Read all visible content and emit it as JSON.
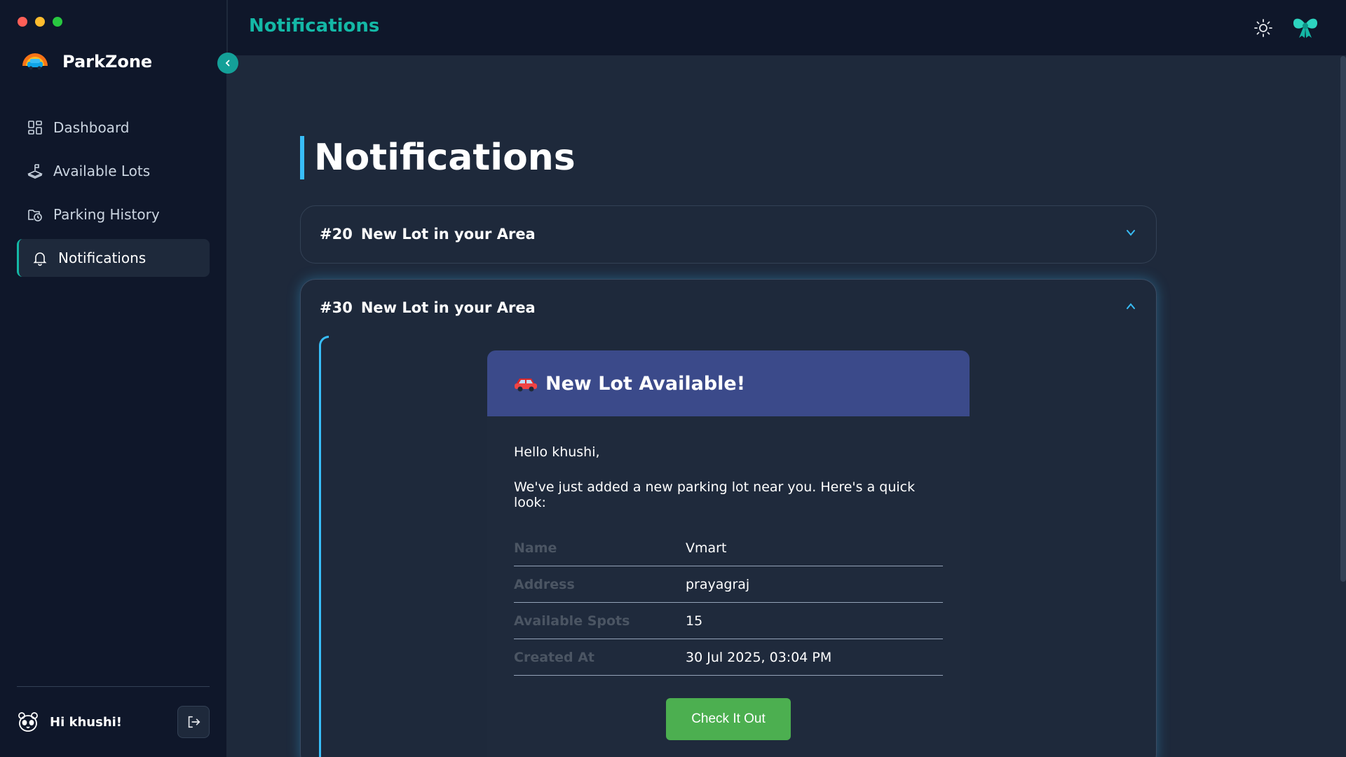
{
  "app": {
    "name": "ParkZone"
  },
  "sidebar": {
    "items": [
      {
        "label": "Dashboard",
        "icon": "dashboard-icon",
        "active": false
      },
      {
        "label": "Available Lots",
        "icon": "parking-lot-icon",
        "active": false
      },
      {
        "label": "Parking History",
        "icon": "history-icon",
        "active": false
      },
      {
        "label": "Notifications",
        "icon": "bell-icon",
        "active": true
      }
    ],
    "user_greeting": "Hi khushi!"
  },
  "topbar": {
    "title": "Notifications"
  },
  "main": {
    "page_title": "Notifications",
    "notifications": [
      {
        "number": "#20",
        "title": "New Lot in your Area",
        "expanded": false
      },
      {
        "number": "#30",
        "title": "New Lot in your Area",
        "expanded": true
      }
    ],
    "email": {
      "heading": "New Lot Available!",
      "greeting": "Hello khushi,",
      "intro": "We've just added a new parking lot near you. Here's a quick look:",
      "details": [
        {
          "label": "Name",
          "value": "Vmart"
        },
        {
          "label": "Address",
          "value": "prayagraj"
        },
        {
          "label": "Available Spots",
          "value": "15"
        },
        {
          "label": "Created At",
          "value": "30 Jul 2025, 03:04 PM"
        }
      ],
      "cta_label": "Check It Out"
    }
  },
  "colors": {
    "accent": "#14b8a6",
    "highlight": "#38bdf8",
    "email_header": "#3b4a8a",
    "cta": "#4caf50"
  }
}
